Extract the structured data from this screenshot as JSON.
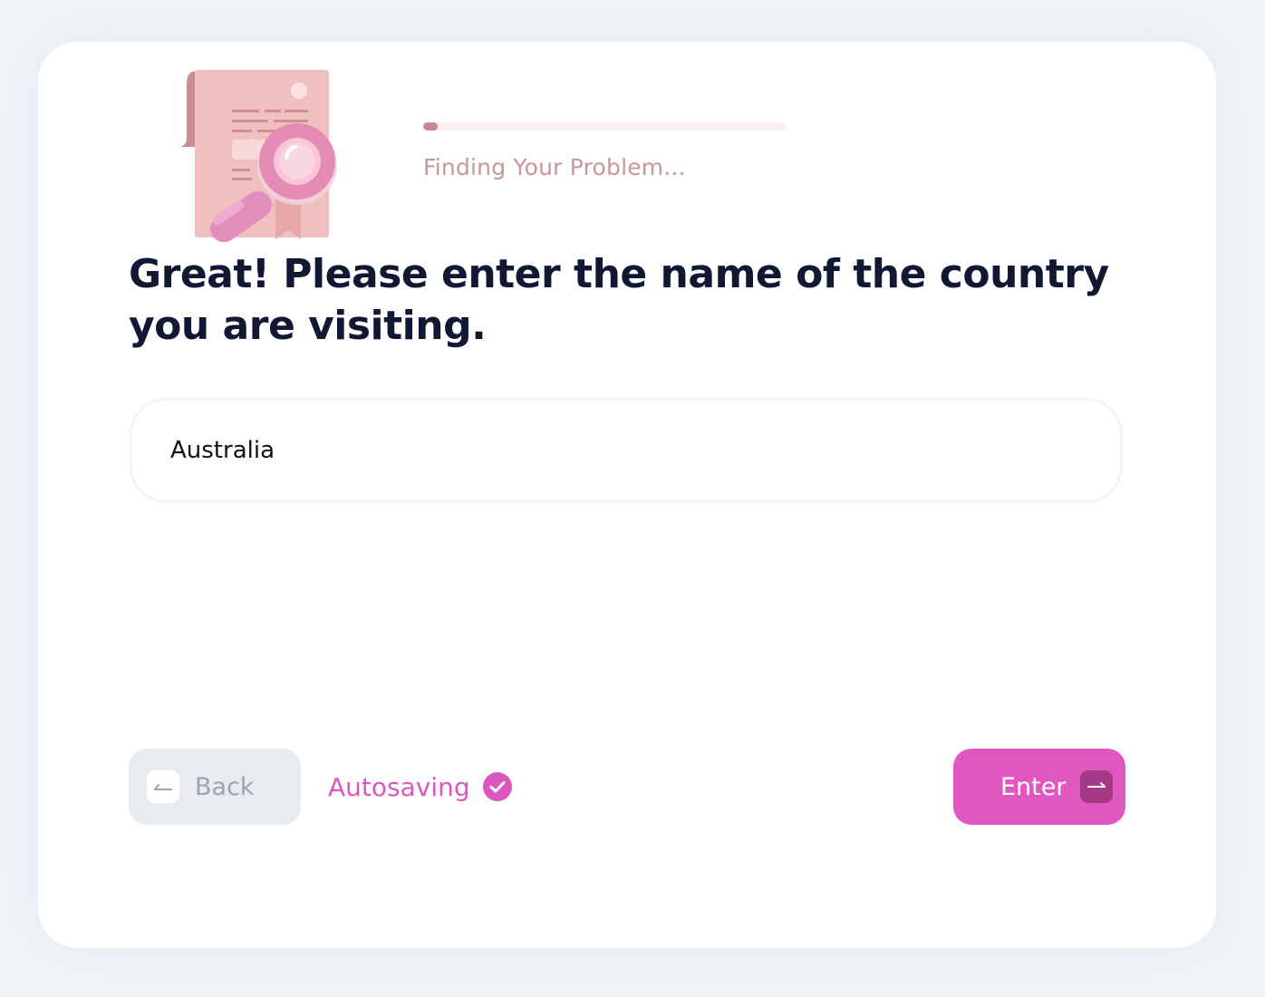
{
  "progress": {
    "label": "Finding Your Problem...",
    "fraction": 0.04
  },
  "question": {
    "text": "Great! Please enter the name of the country you are visiting."
  },
  "answer": {
    "value": "Australia"
  },
  "back_button": {
    "label": "Back",
    "icon": "arrow-left-icon"
  },
  "autosave": {
    "label": "Autosaving",
    "icon": "check-circle-icon"
  },
  "enter_button": {
    "label": "Enter",
    "icon": "arrow-right-icon"
  },
  "colors": {
    "accent": "#e157c0",
    "progress_fill": "#c28a8c",
    "heading": "#111834"
  }
}
